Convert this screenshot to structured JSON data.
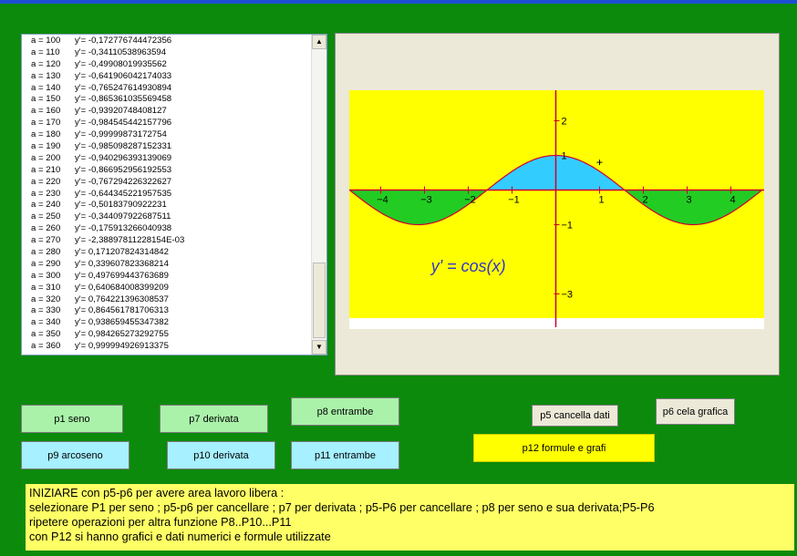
{
  "list": {
    "items": [
      {
        "a": "a = 100",
        "y": "y'= -0,172776744472356"
      },
      {
        "a": "a = 110",
        "y": "y'= -0,34110538963594"
      },
      {
        "a": "a = 120",
        "y": "y'= -0,49908019935562"
      },
      {
        "a": "a = 130",
        "y": "y'= -0,641906042174033"
      },
      {
        "a": "a = 140",
        "y": "y'= -0,765247614930894"
      },
      {
        "a": "a = 150",
        "y": "y'= -0,865361035569458"
      },
      {
        "a": "a = 160",
        "y": "y'= -0,93920748408127"
      },
      {
        "a": "a = 170",
        "y": "y'= -0,984545442157796"
      },
      {
        "a": "a = 180",
        "y": "y'= -0,99999873172754"
      },
      {
        "a": "a = 190",
        "y": "y'= -0,985098287152331"
      },
      {
        "a": "a = 200",
        "y": "y'= -0,940296393139069"
      },
      {
        "a": "a = 210",
        "y": "y'= -0,866952956192553"
      },
      {
        "a": "a = 220",
        "y": "y'= -0,767294226322627"
      },
      {
        "a": "a = 230",
        "y": "y'= -0,644345221957535"
      },
      {
        "a": "a = 240",
        "y": "y'= -0,50183790922231"
      },
      {
        "a": "a = 250",
        "y": "y'= -0,344097922687511"
      },
      {
        "a": "a = 260",
        "y": "y'= -0,175913266040938"
      },
      {
        "a": "a = 270",
        "y": "y'= -2,38897811228154E-03"
      },
      {
        "a": "a = 280",
        "y": "y'= 0,171207824314842"
      },
      {
        "a": "a = 290",
        "y": "y'= 0,339607823368214"
      },
      {
        "a": "a = 300",
        "y": "y'= 0,497699443763689"
      },
      {
        "a": "a = 310",
        "y": "y'= 0,640684008399209"
      },
      {
        "a": "a = 320",
        "y": "y'= 0,764221396308537"
      },
      {
        "a": "a = 330",
        "y": "y'= 0,864561781706313"
      },
      {
        "a": "a = 340",
        "y": "y'= 0,938659455347382"
      },
      {
        "a": "a = 350",
        "y": "y'= 0,984265273292755"
      },
      {
        "a": "a = 360",
        "y": "y'= 0,999994926913375"
      }
    ],
    "scroll_up_glyph": "▲",
    "scroll_down_glyph": "▼"
  },
  "chart_data": {
    "type": "area",
    "function_label": "y' = cos(x)",
    "xlim": [
      -4.7,
      4.7
    ],
    "ylim": [
      -3.2,
      2.3
    ],
    "x_ticks": [
      "−4",
      "−3",
      "−2",
      "−1",
      "1",
      "2",
      "3",
      "4"
    ],
    "x_tick_values": [
      -4,
      -3,
      -2,
      -1,
      1,
      2,
      3,
      4
    ],
    "y_ticks": [
      "2",
      "1",
      "−1",
      "−3"
    ],
    "y_tick_values": [
      2,
      1,
      -1,
      -3
    ],
    "marker_point": [
      1,
      0.8
    ],
    "positive_fill": "#33ccff",
    "negative_fill": "#22cc22",
    "plot_bg": "#ffff00",
    "curve_color": "#cc0033",
    "axis_color": "#cc0033",
    "label_color": "#3333cc"
  },
  "buttons": {
    "p1": "p1 seno",
    "p7": "p7 derivata",
    "p8": "p8 entrambe",
    "p5": "p5 cancella dati",
    "p6": "p6 cela grafica",
    "p9": "p9 arcoseno",
    "p10": "p10 derivata",
    "p11": "p11 entrambe",
    "p12": "p12 formule e grafi"
  },
  "info": {
    "line1": "INIZIARE con p5-p6 per avere area lavoro libera :",
    "line2": "selezionare P1 per seno ; p5-p6 per cancellare ; p7 per derivata ; p5-P6 per cancellare ; p8 per seno e sua derivata;P5-P6",
    "line3": "ripetere operazioni per altra funzione P8..P10...P11",
    "line4": "con P12 si hanno grafici e dati numerici e formule utilizzate"
  }
}
